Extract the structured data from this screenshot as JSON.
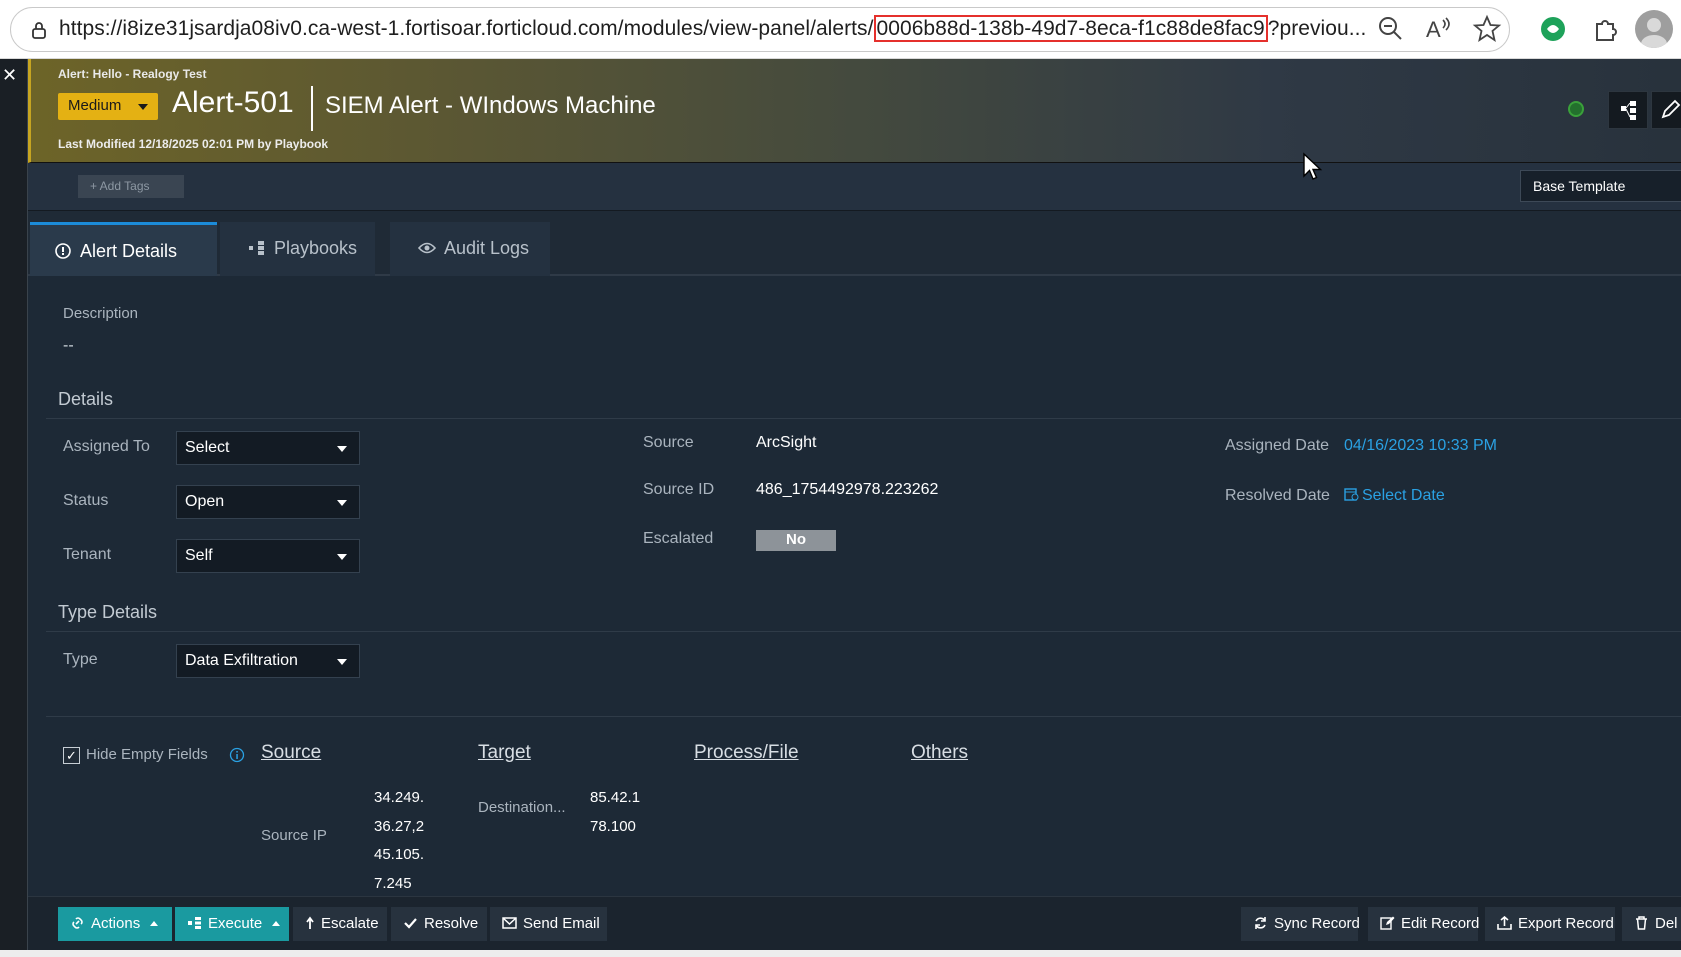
{
  "browser": {
    "url_prefix": "https://i8ize31jsardja08iv0.ca-west-1.fortisoar.forticloud.com/modules/view-panel/alerts/",
    "url_highlight": "0006b88d-138b-49d7-8eca-f1c88de8fac9",
    "url_suffix": "?previou..."
  },
  "header": {
    "subtitle": "Alert: Hello - Realogy Test",
    "severity": "Medium",
    "alert_id": "Alert-501",
    "alert_name": "SIEM Alert - WIndows Machine",
    "last_modified": "Last Modified 12/18/2025 02:01 PM by Playbook",
    "severity_color": "#e4b113"
  },
  "tags": {
    "add_label": "+ Add Tags",
    "template": "Base Template"
  },
  "tabs": [
    {
      "label": "Alert Details",
      "active": true
    },
    {
      "label": "Playbooks",
      "active": false
    },
    {
      "label": "Audit Logs",
      "active": false
    }
  ],
  "description": {
    "label": "Description",
    "value": "--"
  },
  "details": {
    "title": "Details",
    "assigned_to_label": "Assigned To",
    "assigned_to_value": "Select",
    "status_label": "Status",
    "status_value": "Open",
    "tenant_label": "Tenant",
    "tenant_value": "Self",
    "source_label": "Source",
    "source_value": "ArcSight",
    "source_id_label": "Source ID",
    "source_id_value": "486_1754492978.223262",
    "escalated_label": "Escalated",
    "escalated_value": "No",
    "assigned_date_label": "Assigned Date",
    "assigned_date_value": "04/16/2023 10:33 PM",
    "resolved_date_label": "Resolved Date",
    "resolved_date_value": "Select Date"
  },
  "type_details": {
    "title": "Type Details",
    "type_label": "Type",
    "type_value": "Data Exfiltration"
  },
  "indicators": {
    "hide_empty_label": "Hide Empty Fields",
    "hide_empty_checked": true,
    "col_source": "Source",
    "col_target": "Target",
    "col_process": "Process/File",
    "col_others": "Others",
    "source_ip_label": "Source IP",
    "source_ip_lines": [
      "34.249.",
      "36.27,2",
      "45.105.",
      "7.245"
    ],
    "dest_label": "Destination...",
    "dest_lines": [
      "85.42.1",
      "78.100"
    ]
  },
  "footer": {
    "actions": "Actions",
    "execute": "Execute",
    "escalate": "Escalate",
    "resolve": "Resolve",
    "send_email": "Send Email",
    "sync": "Sync Record",
    "edit": "Edit Record",
    "export": "Export Record",
    "delete": "Del"
  }
}
